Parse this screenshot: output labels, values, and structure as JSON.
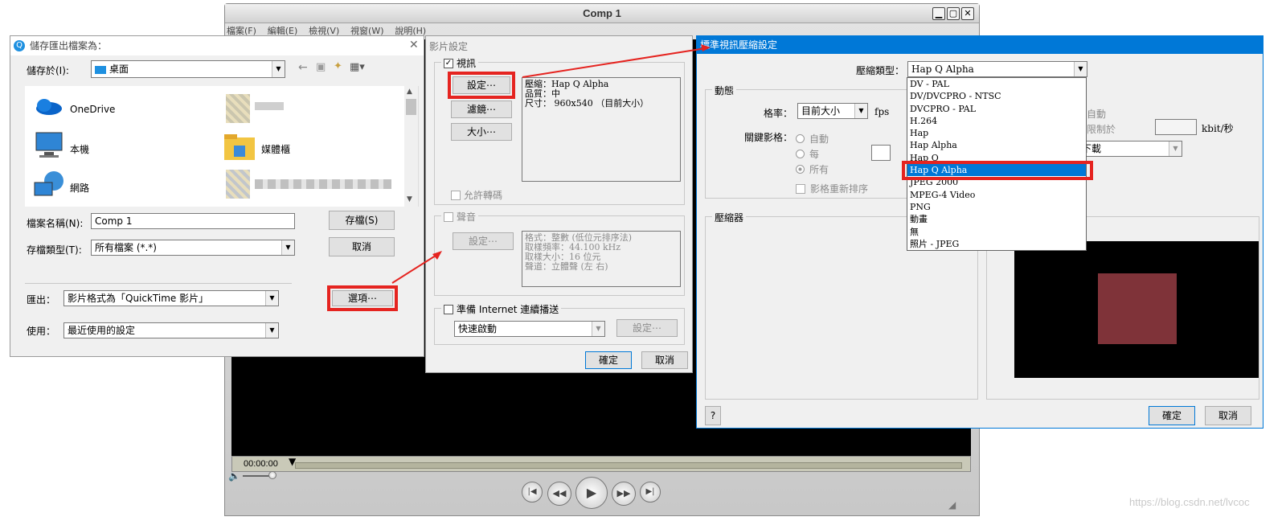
{
  "player": {
    "title": "Comp 1",
    "menu": [
      "檔案(F)",
      "編輯(E)",
      "檢視(V)",
      "視窗(W)",
      "說明(H)"
    ],
    "timecode": "00:00:00",
    "window_buttons": [
      "minimize-icon",
      "maximize-icon",
      "close-icon"
    ]
  },
  "save_dialog": {
    "title": "儲存匯出檔案為：",
    "save_in_label": "儲存於(I):",
    "save_in_value": "桌面",
    "locations": [
      {
        "label": "OneDrive",
        "icon": "onedrive-icon"
      },
      {
        "label": "本機",
        "icon": "computer-icon"
      },
      {
        "label": "網路",
        "icon": "network-icon"
      },
      {
        "label": "媒體櫃",
        "icon": "library-icon"
      }
    ],
    "filename_label": "檔案名稱(N):",
    "filename_value": "Comp 1",
    "filetype_label": "存檔類型(T):",
    "filetype_value": "所有檔案 (*.*)",
    "save_button": "存檔(S)",
    "cancel_button": "取消",
    "export_label": "匯出：",
    "export_value": "影片格式為「QuickTime 影片」",
    "options_button": "選項⋯",
    "use_label": "使用：",
    "use_value": "最近使用的設定"
  },
  "movie_settings": {
    "title": "影片設定",
    "video_label": "視訊",
    "settings_button": "設定⋯",
    "filter_button": "濾鏡⋯",
    "size_button": "大小⋯",
    "video_info": [
      "壓縮：Hap Q Alpha",
      "品質：中",
      "尺寸： 960x540 （目前大小）"
    ],
    "allow_transcode": "允許轉碼",
    "sound_label": "聲音",
    "sound_settings_button": "設定⋯",
    "sound_info": [
      "格式：整數 (低位元排序法)",
      "取樣頻率：44.100 kHz",
      "取樣大小：16 位元",
      "聲道：立體聲 (左 右)"
    ],
    "internet_label": "準備 Internet 連續播送",
    "internet_value": "快速啟動",
    "internet_settings_button": "設定⋯",
    "ok_button": "確定",
    "cancel_button": "取消"
  },
  "compression": {
    "title": "標準視訊壓縮設定",
    "type_label": "壓縮類型：",
    "type_value": "Hap Q Alpha",
    "motion_label": "動態",
    "framerate_label": "格率：",
    "framerate_value": "目前大小",
    "fps_label": "fps",
    "keyframe_label": "關鍵影格：",
    "keyframe_auto": "自動",
    "keyframe_every": "每",
    "keyframe_all": "所有",
    "reorder_label": "影格重新排序",
    "datarate_auto": "自動",
    "datarate_limit": "限制於",
    "kbits_label": "kbit/秒",
    "optimize_value": "下載",
    "compressor_label": "壓縮器",
    "help_button": "?",
    "ok_button": "確定",
    "cancel_button": "取消",
    "options": [
      "DV - PAL",
      "DV/DVCPRO - NTSC",
      "DVCPRO - PAL",
      "H.264",
      "Hap",
      "Hap Alpha",
      "Hap Q",
      "Hap Q Alpha",
      "JPEG 2000",
      "MPEG-4 Video",
      "PNG",
      "動畫",
      "無",
      "照片 - JPEG"
    ],
    "selected_option": "Hap Q Alpha"
  },
  "highlight_color": "#e52420",
  "watermark": "https://blog.csdn.net/lvcoc"
}
